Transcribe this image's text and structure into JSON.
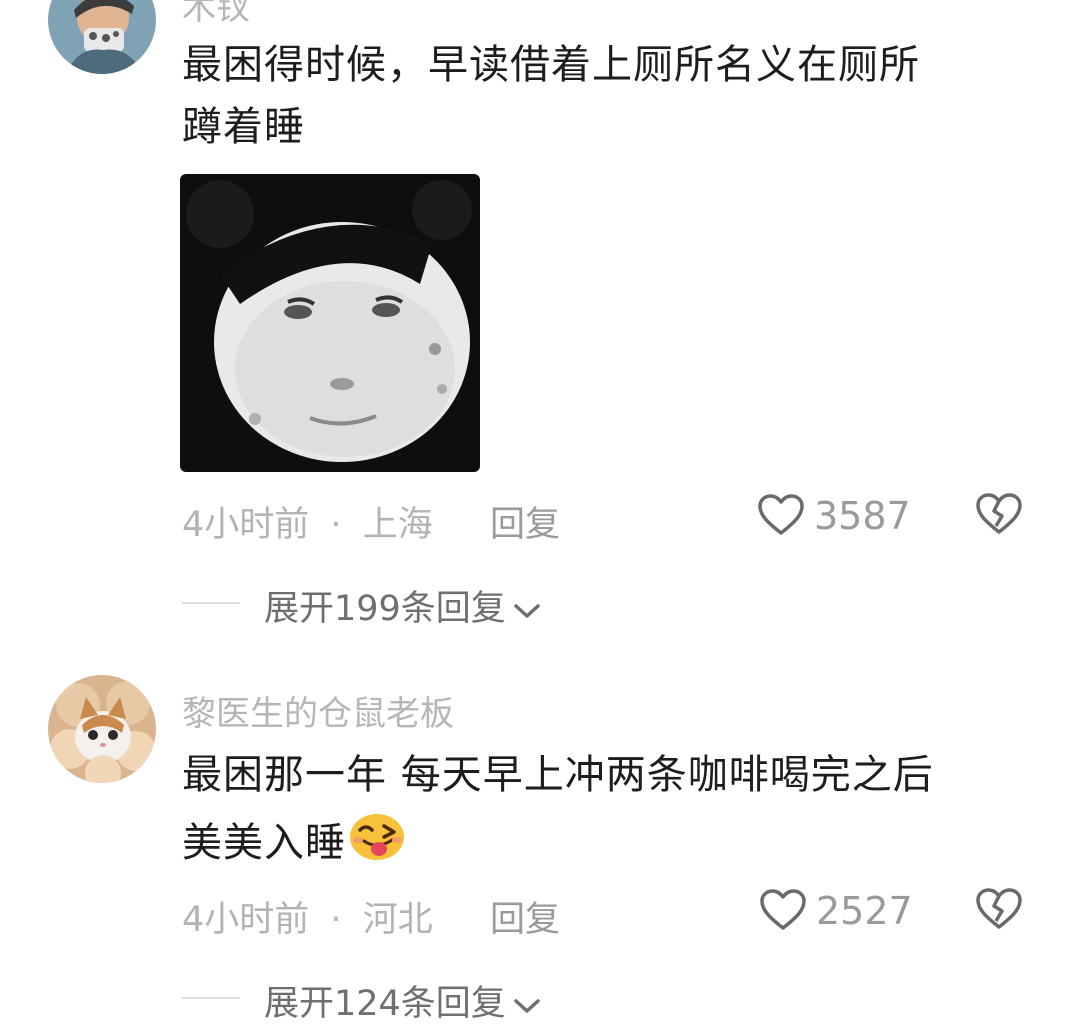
{
  "comments": [
    {
      "username": "木钗",
      "text_line1": "最困得时候，早读借着上厕所名义在厕所",
      "text_line2": "蹲着睡",
      "time": "4小时前",
      "separator": "·",
      "location": "上海",
      "reply_label": "回复",
      "likes": "3587",
      "expand_label": "展开199条回复"
    },
    {
      "username": "黎医生的仓鼠老板",
      "text_line1": "最困那一年 每天早上冲两条咖啡喝完之后",
      "text_line2": "美美入睡",
      "time": "4小时前",
      "separator": "·",
      "location": "河北",
      "reply_label": "回复",
      "likes": "2527",
      "expand_label": "展开124条回复"
    }
  ],
  "icons": {
    "like": "heart-outline-icon",
    "dislike": "broken-heart-icon",
    "expand": "chevron-down-icon",
    "emoji": "winking-tongue-emoji"
  }
}
